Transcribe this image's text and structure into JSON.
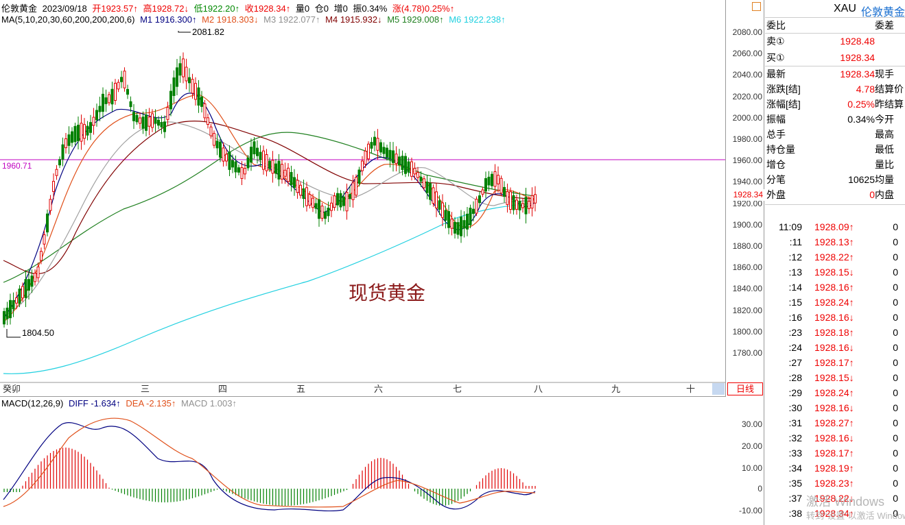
{
  "header": {
    "symbol": "伦敦黄金",
    "date": "2023/09/18",
    "open": "开1923.57↑",
    "high": "高1928.72↓",
    "low": "低1922.20↑",
    "close": "收1928.34↑",
    "volume": "量0",
    "position": "仓0",
    "increase": "增0",
    "amplitude": "振0.34%",
    "change": "涨(4.78)0.25%↑"
  },
  "ma": {
    "label": "MA(5,10,20,30,60,200,200,200,6)",
    "m1": "M1 1916.300↑",
    "m2": "M2 1918.303↓",
    "m3": "M3 1922.077↑",
    "m4": "M4 1915.932↓",
    "m5": "M5 1929.008↑",
    "m6": "M6 1922.238↑"
  },
  "colors": {
    "up": "#e00000",
    "down": "#008000",
    "m1": "#000080",
    "m2": "#e0501a",
    "m3": "#a0a0a0",
    "m4": "#800000",
    "m5": "#208020",
    "m6": "#20d0e0",
    "ref_line": "#c000c0"
  },
  "annotations": {
    "high_label": "2081.82",
    "low_label": "1804.50",
    "ref_label": "1960.71",
    "watermark_text": "现货黄金",
    "price_tag": "1928.34"
  },
  "yaxis_ticks": [
    "2080.00",
    "2060.00",
    "2040.00",
    "2020.00",
    "2000.00",
    "1980.00",
    "1960.00",
    "1940.00",
    "1920.00",
    "1900.00",
    "1880.00",
    "1860.00",
    "1840.00",
    "1820.00",
    "1800.00",
    "1780.00"
  ],
  "x_labels": [
    "癸卯",
    "三",
    "四",
    "五",
    "六",
    "七",
    "八",
    "九",
    "十"
  ],
  "period_button": "日线",
  "macd": {
    "label": "MACD(12,26,9)",
    "diff": "DIFF -1.634↑",
    "dea": "DEA -2.135↑",
    "macd": "MACD 1.003↑",
    "ticks": [
      "30.00",
      "20.00",
      "10.00",
      "0",
      "-10.00"
    ]
  },
  "side": {
    "title": "XAU",
    "title_cn": "伦敦黄金",
    "weibi_label": "委比",
    "weicha_label": "委差",
    "sell_label": "卖①",
    "sell_value": "1928.48",
    "buy_label": "买①",
    "buy_value": "1928.34",
    "rows": [
      {
        "label": "最新",
        "value": "1928.34",
        "label2": "现手",
        "red": true
      },
      {
        "label": "涨跌[结]",
        "value": "4.78",
        "label2": "结算价",
        "red": true
      },
      {
        "label": "涨幅[结]",
        "value": "0.25%",
        "label2": "昨结算",
        "red": true
      },
      {
        "label": "振幅",
        "value": "0.34%",
        "label2": "今开",
        "red": false
      },
      {
        "label": "总手",
        "value": "",
        "label2": "最高",
        "red": false
      },
      {
        "label": "持仓量",
        "value": "",
        "label2": "最低",
        "red": false
      },
      {
        "label": "增仓",
        "value": "",
        "label2": "量比",
        "red": false
      },
      {
        "label": "分笔",
        "value": "10625",
        "label2": "均量",
        "red": false
      },
      {
        "label": "外盘",
        "value": "0",
        "label2": "内盘",
        "red": true
      }
    ],
    "ticks": [
      {
        "t": "11:09",
        "p": "1928.09↑",
        "v": "0"
      },
      {
        "t": ":11",
        "p": "1928.13↑",
        "v": "0"
      },
      {
        "t": ":12",
        "p": "1928.22↑",
        "v": "0"
      },
      {
        "t": ":13",
        "p": "1928.15↓",
        "v": "0"
      },
      {
        "t": ":14",
        "p": "1928.16↑",
        "v": "0"
      },
      {
        "t": ":15",
        "p": "1928.24↑",
        "v": "0"
      },
      {
        "t": ":16",
        "p": "1928.16↓",
        "v": "0"
      },
      {
        "t": ":23",
        "p": "1928.18↑",
        "v": "0"
      },
      {
        "t": ":24",
        "p": "1928.16↓",
        "v": "0"
      },
      {
        "t": ":27",
        "p": "1928.17↑",
        "v": "0"
      },
      {
        "t": ":28",
        "p": "1928.15↓",
        "v": "0"
      },
      {
        "t": ":29",
        "p": "1928.24↑",
        "v": "0"
      },
      {
        "t": ":30",
        "p": "1928.16↓",
        "v": "0"
      },
      {
        "t": ":31",
        "p": "1928.27↑",
        "v": "0"
      },
      {
        "t": ":32",
        "p": "1928.16↓",
        "v": "0"
      },
      {
        "t": ":33",
        "p": "1928.17↑",
        "v": "0"
      },
      {
        "t": ":34",
        "p": "1928.19↑",
        "v": "0"
      },
      {
        "t": ":35",
        "p": "1928.23↑",
        "v": "0"
      },
      {
        "t": ":37",
        "p": "1928.22↓",
        "v": "0"
      },
      {
        "t": ":38",
        "p": "1928.34↑",
        "v": "0"
      }
    ],
    "windows_watermark": "激活 Windows",
    "windows_watermark2": "转到“设置”以激活 Windows。"
  }
}
